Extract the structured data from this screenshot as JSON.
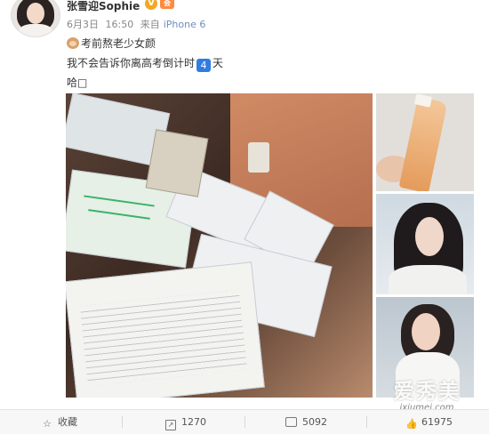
{
  "post": {
    "username": "张雪迎Sophie",
    "verified_mark": "V",
    "member_badge": "会",
    "date": "6月3日",
    "time": "16:50",
    "source_prefix": "来自",
    "source": "iPhone 6",
    "text_line1": "考前熬老少女颜",
    "text_line2_before": "我不会告诉你离高考倒计时",
    "countdown_number": "4",
    "text_line2_after": "天",
    "text_line3": "哈□",
    "icons": {
      "line1_emoji": "dog-emoji-icon",
      "countdown": "number-4-emoji-icon"
    }
  },
  "watermark": {
    "cn": "爱秀美",
    "en": "ixiumei.com"
  },
  "actions": {
    "favorite": {
      "label": "收藏",
      "icon": "star-icon"
    },
    "repost": {
      "count": "1270",
      "icon": "repost-icon"
    },
    "comment": {
      "count": "5092",
      "icon": "comment-icon"
    },
    "like": {
      "count": "61975",
      "icon": "thumbs-up-icon"
    }
  },
  "colors": {
    "verified": "#f5a623",
    "countdown_badge": "#2f7de1",
    "source_link": "#6a8fbf"
  }
}
